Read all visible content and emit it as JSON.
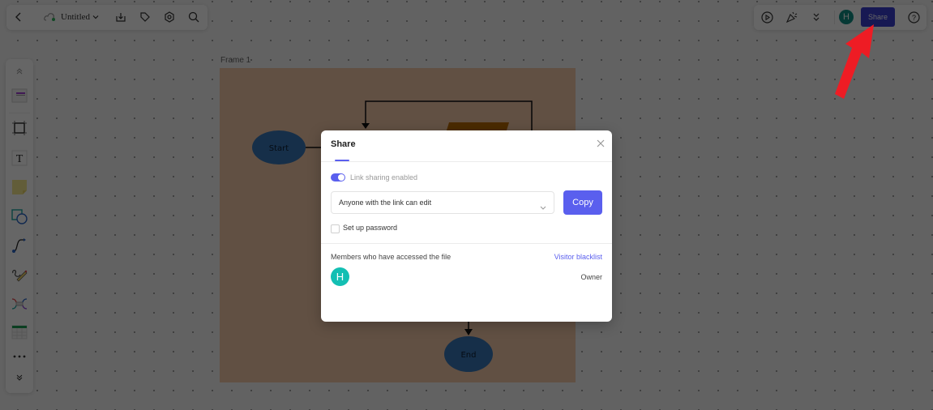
{
  "topbar": {
    "title": "Untitled",
    "icons": [
      "back-icon",
      "cloud-sync-icon",
      "chevron-down-icon",
      "download-icon",
      "tag-icon",
      "settings-icon",
      "search-icon"
    ]
  },
  "topbar_right": {
    "icons": [
      "present-icon",
      "celebrate-icon",
      "expand-more-icon",
      "help-icon"
    ],
    "avatar_initial": "H",
    "share_label": "Share"
  },
  "sidebar": {
    "items": [
      "collapse-up",
      "template",
      "frame",
      "text",
      "sticky-note",
      "shape",
      "connector",
      "pen",
      "mindmap",
      "table",
      "more",
      "expand-down"
    ]
  },
  "canvas": {
    "frame_label": "Frame 1",
    "nodes": [
      {
        "type": "ellipse",
        "label": "Start"
      },
      {
        "type": "parallelogram",
        "label": ""
      },
      {
        "type": "ellipse",
        "label": "End"
      }
    ]
  },
  "dialog": {
    "title": "Share",
    "link_sharing_label": "Link sharing enabled",
    "link_sharing_enabled": true,
    "permission_value": "Anyone with the link can edit",
    "copy_label": "Copy",
    "password_label": "Set up password",
    "password_checked": false,
    "members_heading": "Members who have accessed the file",
    "blacklist_link": "Visitor blacklist",
    "members": [
      {
        "initial": "H",
        "role": "Owner"
      }
    ]
  },
  "colors": {
    "accent": "#5a5fee",
    "avatar": "#13bfb3",
    "annotation_arrow": "#ee1c24"
  }
}
